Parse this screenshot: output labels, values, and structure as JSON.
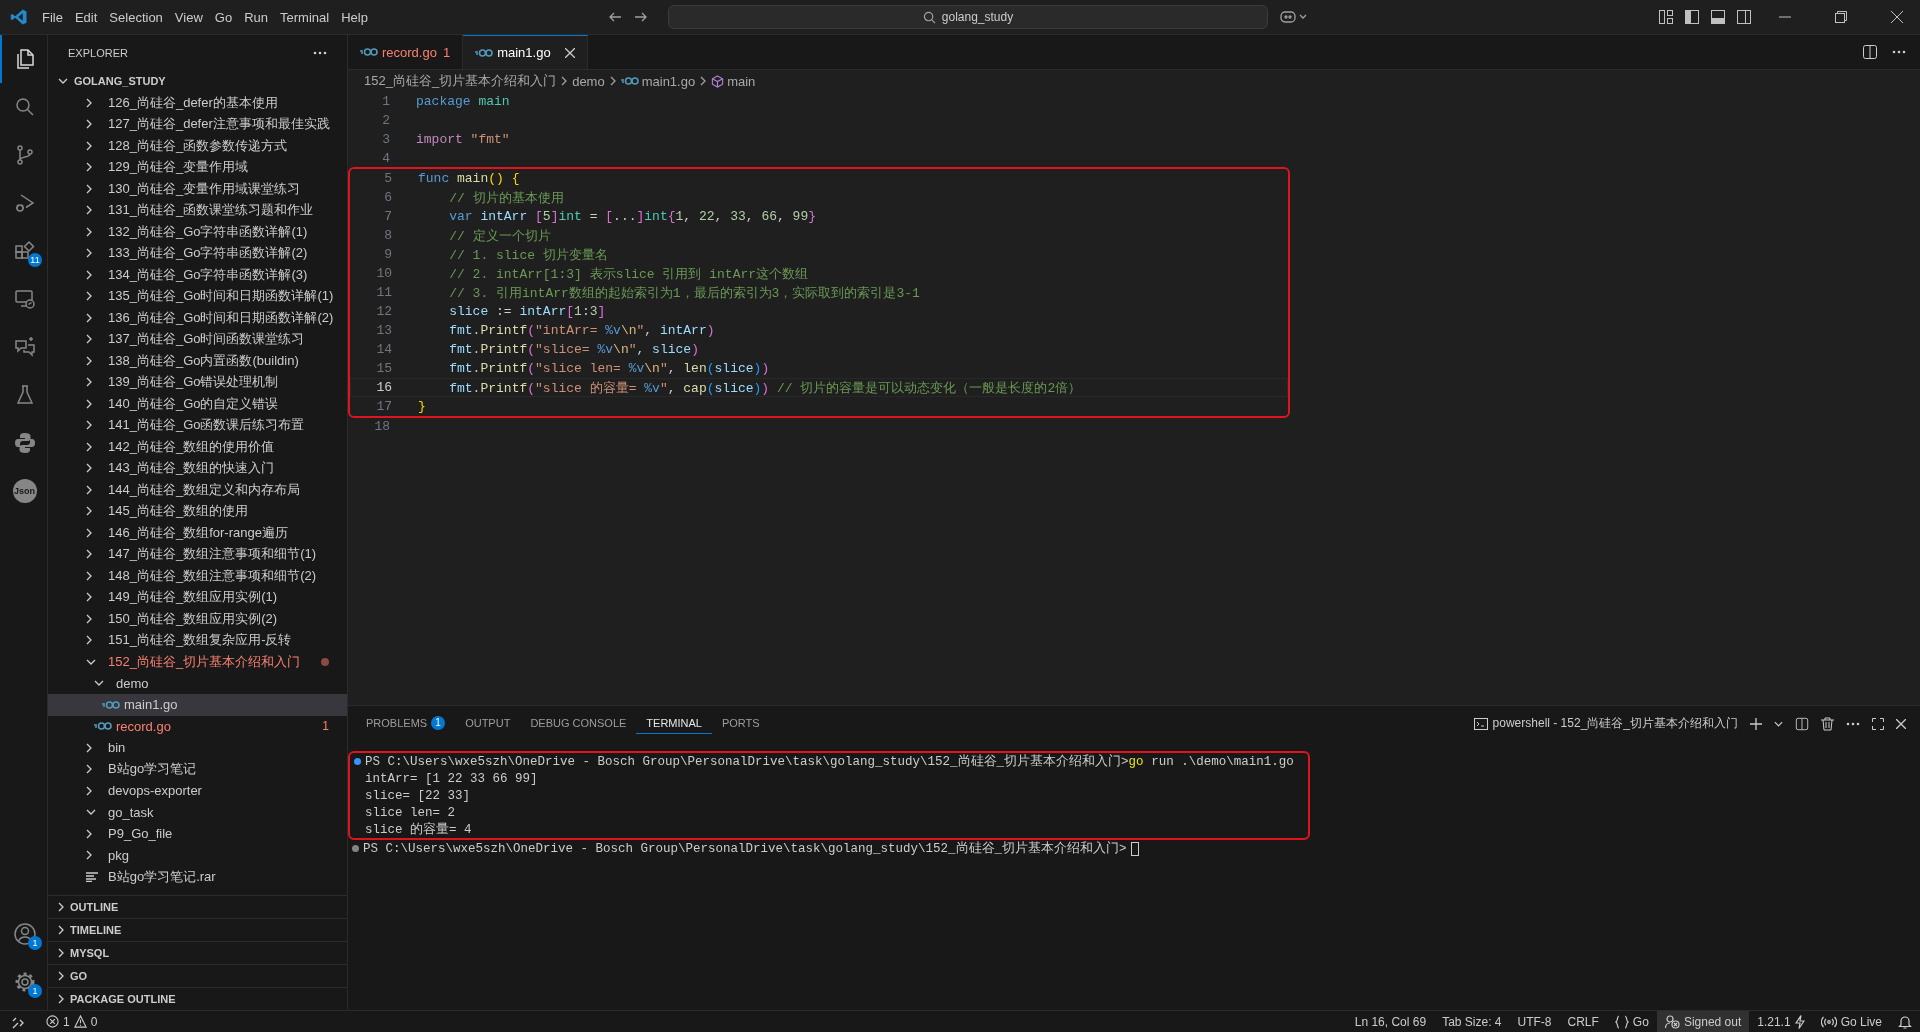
{
  "title_bar": {
    "menus": [
      "File",
      "Edit",
      "Selection",
      "View",
      "Go",
      "Run",
      "Terminal",
      "Help"
    ],
    "search": "golang_study"
  },
  "activity_bar": {
    "top": [
      {
        "kind": "files",
        "selected": true
      },
      {
        "kind": "search",
        "selected": false
      },
      {
        "kind": "source-control",
        "selected": false
      },
      {
        "kind": "run-debug",
        "selected": false
      },
      {
        "kind": "extensions",
        "selected": false,
        "badge": "11"
      },
      {
        "kind": "remote",
        "selected": false
      },
      {
        "kind": "chat",
        "selected": false
      },
      {
        "kind": "testing",
        "selected": false
      },
      {
        "kind": "python",
        "selected": false
      },
      {
        "kind": "json",
        "selected": false,
        "label": "Json"
      }
    ],
    "bottom": [
      {
        "kind": "account",
        "selected": false,
        "badge": "1"
      },
      {
        "kind": "settings",
        "selected": false,
        "badge": "1"
      }
    ]
  },
  "sidebar": {
    "title": "EXPLORER",
    "root": {
      "label": "GOLANG_STUDY",
      "expanded": true,
      "children": [
        {
          "kind": "folder",
          "label": "126_尚硅谷_defer的基本使用",
          "expanded": false,
          "selected": false,
          "has_error": false
        },
        {
          "kind": "folder",
          "label": "127_尚硅谷_defer注意事项和最佳实践",
          "expanded": false,
          "selected": false,
          "has_error": false
        },
        {
          "kind": "folder",
          "label": "128_尚硅谷_函数参数传递方式",
          "expanded": false,
          "selected": false,
          "has_error": false
        },
        {
          "kind": "folder",
          "label": "129_尚硅谷_变量作用域",
          "expanded": false,
          "selected": false,
          "has_error": false
        },
        {
          "kind": "folder",
          "label": "130_尚硅谷_变量作用域课堂练习",
          "expanded": false,
          "selected": false,
          "has_error": false
        },
        {
          "kind": "folder",
          "label": "131_尚硅谷_函数课堂练习题和作业",
          "expanded": false,
          "selected": false,
          "has_error": false
        },
        {
          "kind": "folder",
          "label": "132_尚硅谷_Go字符串函数详解(1)",
          "expanded": false,
          "selected": false,
          "has_error": false
        },
        {
          "kind": "folder",
          "label": "133_尚硅谷_Go字符串函数详解(2)",
          "expanded": false,
          "selected": false,
          "has_error": false
        },
        {
          "kind": "folder",
          "label": "134_尚硅谷_Go字符串函数详解(3)",
          "expanded": false,
          "selected": false,
          "has_error": false
        },
        {
          "kind": "folder",
          "label": "135_尚硅谷_Go时间和日期函数详解(1)",
          "expanded": false,
          "selected": false,
          "has_error": false
        },
        {
          "kind": "folder",
          "label": "136_尚硅谷_Go时间和日期函数详解(2)",
          "expanded": false,
          "selected": false,
          "has_error": false
        },
        {
          "kind": "folder",
          "label": "137_尚硅谷_Go时间函数课堂练习",
          "expanded": false,
          "selected": false,
          "has_error": false
        },
        {
          "kind": "folder",
          "label": "138_尚硅谷_Go内置函数(buildin)",
          "expanded": false,
          "selected": false,
          "has_error": false
        },
        {
          "kind": "folder",
          "label": "139_尚硅谷_Go错误处理机制",
          "expanded": false,
          "selected": false,
          "has_error": false
        },
        {
          "kind": "folder",
          "label": "140_尚硅谷_Go的自定义错误",
          "expanded": false,
          "selected": false,
          "has_error": false
        },
        {
          "kind": "folder",
          "label": "141_尚硅谷_Go函数课后练习布置",
          "expanded": false,
          "selected": false,
          "has_error": false
        },
        {
          "kind": "folder",
          "label": "142_尚硅谷_数组的使用价值",
          "expanded": false,
          "selected": false,
          "has_error": false
        },
        {
          "kind": "folder",
          "label": "143_尚硅谷_数组的快速入门",
          "expanded": false,
          "selected": false,
          "has_error": false
        },
        {
          "kind": "folder",
          "label": "144_尚硅谷_数组定义和内存布局",
          "expanded": false,
          "selected": false,
          "has_error": false
        },
        {
          "kind": "folder",
          "label": "145_尚硅谷_数组的使用",
          "expanded": false,
          "selected": false,
          "has_error": false
        },
        {
          "kind": "folder",
          "label": "146_尚硅谷_数组for-range遍历",
          "expanded": false,
          "selected": false,
          "has_error": false
        },
        {
          "kind": "folder",
          "label": "147_尚硅谷_数组注意事项和细节(1)",
          "expanded": false,
          "selected": false,
          "has_error": false
        },
        {
          "kind": "folder",
          "label": "148_尚硅谷_数组注意事项和细节(2)",
          "expanded": false,
          "selected": false,
          "has_error": false
        },
        {
          "kind": "folder",
          "label": "149_尚硅谷_数组应用实例(1)",
          "expanded": false,
          "selected": false,
          "has_error": false
        },
        {
          "kind": "folder",
          "label": "150_尚硅谷_数组应用实例(2)",
          "expanded": false,
          "selected": false,
          "has_error": false
        },
        {
          "kind": "folder",
          "label": "151_尚硅谷_数组复杂应用-反转",
          "expanded": false,
          "selected": false,
          "has_error": false
        },
        {
          "kind": "folder",
          "label": "152_尚硅谷_切片基本介绍和入门",
          "expanded": true,
          "selected": false,
          "has_error": true,
          "children": [
            {
              "kind": "folder",
              "label": "demo",
              "expanded": true,
              "selected": false,
              "has_error": false,
              "children": [
                {
                  "kind": "go-file",
                  "label": "main1.go",
                  "selected": true,
                  "has_error": false
                }
              ]
            },
            {
              "kind": "go-file",
              "label": "record.go",
              "selected": false,
              "has_error": true,
              "badge": "1"
            }
          ]
        },
        {
          "kind": "folder",
          "label": "bin",
          "expanded": false,
          "selected": false,
          "has_error": false
        },
        {
          "kind": "folder",
          "label": "B站go学习笔记",
          "expanded": false,
          "selected": false,
          "has_error": false
        },
        {
          "kind": "folder",
          "label": "devops-exporter",
          "expanded": false,
          "selected": false,
          "has_error": false
        },
        {
          "kind": "folder",
          "label": "go_task",
          "expanded": true,
          "selected": false,
          "has_error": false
        },
        {
          "kind": "folder",
          "label": "P9_Go_file",
          "expanded": false,
          "selected": false,
          "has_error": false
        },
        {
          "kind": "folder",
          "label": "pkg",
          "expanded": false,
          "selected": false,
          "has_error": false
        },
        {
          "kind": "archive",
          "label": "B站go学习笔记.rar",
          "selected": false,
          "has_error": false
        }
      ]
    },
    "sections": [
      {
        "label": "OUTLINE",
        "expanded": false
      },
      {
        "label": "TIMELINE",
        "expanded": false
      },
      {
        "label": "MYSQL",
        "expanded": false
      },
      {
        "label": "GO",
        "expanded": false
      },
      {
        "label": "PACKAGE OUTLINE",
        "expanded": false
      }
    ]
  },
  "tabs": [
    {
      "label": "record.go",
      "selected": false,
      "has_error": true,
      "badge": "1"
    },
    {
      "label": "main1.go",
      "selected": true,
      "has_error": false
    }
  ],
  "breadcrumb": [
    {
      "kind": "folder",
      "label": "152_尚硅谷_切片基本介绍和入门"
    },
    {
      "kind": "folder",
      "label": "demo"
    },
    {
      "kind": "go-file",
      "label": "main1.go"
    },
    {
      "kind": "symbol",
      "label": "main"
    }
  ],
  "code": {
    "blocks": [
      {
        "boxed": false,
        "lines": [
          {
            "number": "1",
            "current": false,
            "tokens": [
              {
                "kind": "keyword",
                "text": "package"
              },
              {
                "kind": "type",
                "text": " main"
              }
            ]
          },
          {
            "number": "2",
            "current": false
          },
          {
            "number": "3",
            "current": false,
            "tokens": [
              {
                "kind": "control",
                "text": "import"
              },
              {
                "kind": "string",
                "text": " \"fmt\""
              }
            ]
          },
          {
            "number": "4",
            "current": false
          }
        ]
      },
      {
        "boxed": true,
        "lines": [
          {
            "number": "5",
            "current": false,
            "tokens": [
              {
                "kind": "keyword",
                "text": "func"
              },
              {
                "kind": "function",
                "text": " main"
              },
              {
                "kind": "bracket1",
                "text": "()"
              },
              {
                "kind": "bracket1",
                "text": " {"
              }
            ]
          },
          {
            "number": "6",
            "current": false,
            "tokens": [
              {
                "kind": "comment",
                "text": "    // 切片的基本使用"
              }
            ]
          },
          {
            "number": "7",
            "current": false,
            "tokens": [
              {
                "kind": "keyword",
                "text": "    var"
              },
              {
                "kind": "variable",
                "text": " intArr"
              },
              {
                "kind": "bracket2",
                "text": " ["
              },
              {
                "kind": "number",
                "text": "5"
              },
              {
                "kind": "bracket2",
                "text": "]"
              },
              {
                "kind": "type",
                "text": "int"
              },
              {
                "kind": "plain",
                "text": " = "
              },
              {
                "kind": "bracket2",
                "text": "["
              },
              {
                "kind": "plain",
                "text": "..."
              },
              {
                "kind": "bracket2",
                "text": "]"
              },
              {
                "kind": "type",
                "text": "int"
              },
              {
                "kind": "bracket2",
                "text": "{"
              },
              {
                "kind": "number",
                "text": "1"
              },
              {
                "kind": "plain",
                "text": ","
              },
              {
                "kind": "number",
                "text": " 22"
              },
              {
                "kind": "plain",
                "text": ","
              },
              {
                "kind": "number",
                "text": " 33"
              },
              {
                "kind": "plain",
                "text": ","
              },
              {
                "kind": "number",
                "text": " 66"
              },
              {
                "kind": "plain",
                "text": ","
              },
              {
                "kind": "number",
                "text": " 99"
              },
              {
                "kind": "bracket2",
                "text": "}"
              }
            ]
          },
          {
            "number": "8",
            "current": false,
            "tokens": [
              {
                "kind": "comment",
                "text": "    // 定义一个切片"
              }
            ]
          },
          {
            "number": "9",
            "current": false,
            "tokens": [
              {
                "kind": "comment",
                "text": "    // 1. slice 切片变量名"
              }
            ]
          },
          {
            "number": "10",
            "current": false,
            "tokens": [
              {
                "kind": "comment",
                "text": "    // 2. intArr[1:3] 表示slice 引用到 intArr这个数组"
              }
            ]
          },
          {
            "number": "11",
            "current": false,
            "tokens": [
              {
                "kind": "comment",
                "text": "    // 3. 引用intArr数组的起始索引为1，最后的索引为3，实际取到的索引是3-1"
              }
            ]
          },
          {
            "number": "12",
            "current": false,
            "tokens": [
              {
                "kind": "variable",
                "text": "    slice"
              },
              {
                "kind": "plain",
                "text": " := "
              },
              {
                "kind": "variable",
                "text": "intArr"
              },
              {
                "kind": "bracket2",
                "text": "["
              },
              {
                "kind": "number",
                "text": "1"
              },
              {
                "kind": "plain",
                "text": ":"
              },
              {
                "kind": "number",
                "text": "3"
              },
              {
                "kind": "bracket2",
                "text": "]"
              }
            ]
          },
          {
            "number": "13",
            "current": false,
            "tokens": [
              {
                "kind": "variable",
                "text": "    fmt"
              },
              {
                "kind": "plain",
                "text": "."
              },
              {
                "kind": "function",
                "text": "Printf"
              },
              {
                "kind": "bracket2",
                "text": "("
              },
              {
                "kind": "string",
                "text": "\"intArr= "
              },
              {
                "kind": "format",
                "text": "%v"
              },
              {
                "kind": "escape",
                "text": "\\n"
              },
              {
                "kind": "string",
                "text": "\""
              },
              {
                "kind": "plain",
                "text": ","
              },
              {
                "kind": "variable",
                "text": " intArr"
              },
              {
                "kind": "bracket2",
                "text": ")"
              }
            ]
          },
          {
            "number": "14",
            "current": false,
            "tokens": [
              {
                "kind": "variable",
                "text": "    fmt"
              },
              {
                "kind": "plain",
                "text": "."
              },
              {
                "kind": "function",
                "text": "Printf"
              },
              {
                "kind": "bracket2",
                "text": "("
              },
              {
                "kind": "string",
                "text": "\"slice= "
              },
              {
                "kind": "format",
                "text": "%v"
              },
              {
                "kind": "escape",
                "text": "\\n"
              },
              {
                "kind": "string",
                "text": "\""
              },
              {
                "kind": "plain",
                "text": ","
              },
              {
                "kind": "variable",
                "text": " slice"
              },
              {
                "kind": "bracket2",
                "text": ")"
              }
            ]
          },
          {
            "number": "15",
            "current": false,
            "tokens": [
              {
                "kind": "variable",
                "text": "    fmt"
              },
              {
                "kind": "plain",
                "text": "."
              },
              {
                "kind": "function",
                "text": "Printf"
              },
              {
                "kind": "bracket2",
                "text": "("
              },
              {
                "kind": "string",
                "text": "\"slice len= "
              },
              {
                "kind": "format",
                "text": "%v"
              },
              {
                "kind": "escape",
                "text": "\\n"
              },
              {
                "kind": "string",
                "text": "\""
              },
              {
                "kind": "plain",
                "text": ","
              },
              {
                "kind": "function",
                "text": " len"
              },
              {
                "kind": "bracket3",
                "text": "("
              },
              {
                "kind": "variable",
                "text": "slice"
              },
              {
                "kind": "bracket3",
                "text": ")"
              },
              {
                "kind": "bracket2",
                "text": ")"
              }
            ]
          },
          {
            "number": "16",
            "current": true,
            "tokens": [
              {
                "kind": "variable",
                "text": "    fmt"
              },
              {
                "kind": "plain",
                "text": "."
              },
              {
                "kind": "function",
                "text": "Printf"
              },
              {
                "kind": "bracket2",
                "text": "("
              },
              {
                "kind": "string",
                "text": "\"slice 的容量= "
              },
              {
                "kind": "format",
                "text": "%v"
              },
              {
                "kind": "string",
                "text": "\""
              },
              {
                "kind": "plain",
                "text": ","
              },
              {
                "kind": "function",
                "text": " cap"
              },
              {
                "kind": "bracket3",
                "text": "("
              },
              {
                "kind": "variable",
                "text": "slice"
              },
              {
                "kind": "bracket3",
                "text": ")"
              },
              {
                "kind": "bracket2",
                "text": ")"
              },
              {
                "kind": "comment",
                "text": " // 切片的容量是可以动态变化（一般是长度的2倍）"
              }
            ]
          },
          {
            "number": "17",
            "current": false,
            "tokens": [
              {
                "kind": "bracket1",
                "text": "}"
              }
            ]
          }
        ]
      },
      {
        "boxed": false,
        "lines": [
          {
            "number": "18",
            "current": false
          }
        ]
      }
    ]
  },
  "panel": {
    "tabs": [
      {
        "label": "PROBLEMS",
        "selected": false,
        "badge": "1"
      },
      {
        "label": "OUTPUT",
        "selected": false
      },
      {
        "label": "DEBUG CONSOLE",
        "selected": false
      },
      {
        "label": "TERMINAL",
        "selected": true
      },
      {
        "label": "PORTS",
        "selected": false
      }
    ],
    "terminal_title": "powershell - 152_尚硅谷_切片基本介绍和入门",
    "terminal": {
      "blocks": [
        {
          "boxed": true,
          "lines": [
            {
              "kind": "prompt",
              "color": "#3794ff",
              "prompt": "PS C:\\Users\\wxe5szh\\OneDrive - Bosch Group\\PersonalDrive\\task\\golang_study\\152_尚硅谷_切片基本介绍和入门>",
              "command": "go",
              "args": "run .\\demo\\main1.go"
            },
            {
              "kind": "output",
              "text": "intArr= [1 22 33 66 99]"
            },
            {
              "kind": "output",
              "text": "slice= [22 33]"
            },
            {
              "kind": "output",
              "text": "slice len= 2"
            },
            {
              "kind": "output",
              "text": "slice 的容量= 4"
            }
          ]
        },
        {
          "boxed": false,
          "lines": [
            {
              "kind": "prompt",
              "color": "#848484",
              "prompt": "PS C:\\Users\\wxe5szh\\OneDrive - Bosch Group\\PersonalDrive\\task\\golang_study\\152_尚硅谷_切片基本介绍和入门>",
              "cursor": true
            }
          ]
        }
      ]
    }
  },
  "status_bar": {
    "errors": "1",
    "warnings": "0",
    "items": [
      {
        "kind": "text",
        "label": "Ln 16, Col 69",
        "highlighted": false
      },
      {
        "kind": "text",
        "label": "Tab Size: 4",
        "highlighted": false
      },
      {
        "kind": "text",
        "label": "UTF-8",
        "highlighted": false
      },
      {
        "kind": "text",
        "label": "CRLF",
        "highlighted": false
      },
      {
        "kind": "language",
        "label": "Go",
        "highlighted": false
      },
      {
        "kind": "account",
        "label": "Signed out",
        "highlighted": true
      },
      {
        "kind": "version",
        "label": "1.21.1",
        "highlighted": false
      },
      {
        "kind": "live",
        "label": "Go Live",
        "highlighted": false
      },
      {
        "kind": "bell",
        "highlighted": false
      }
    ]
  }
}
